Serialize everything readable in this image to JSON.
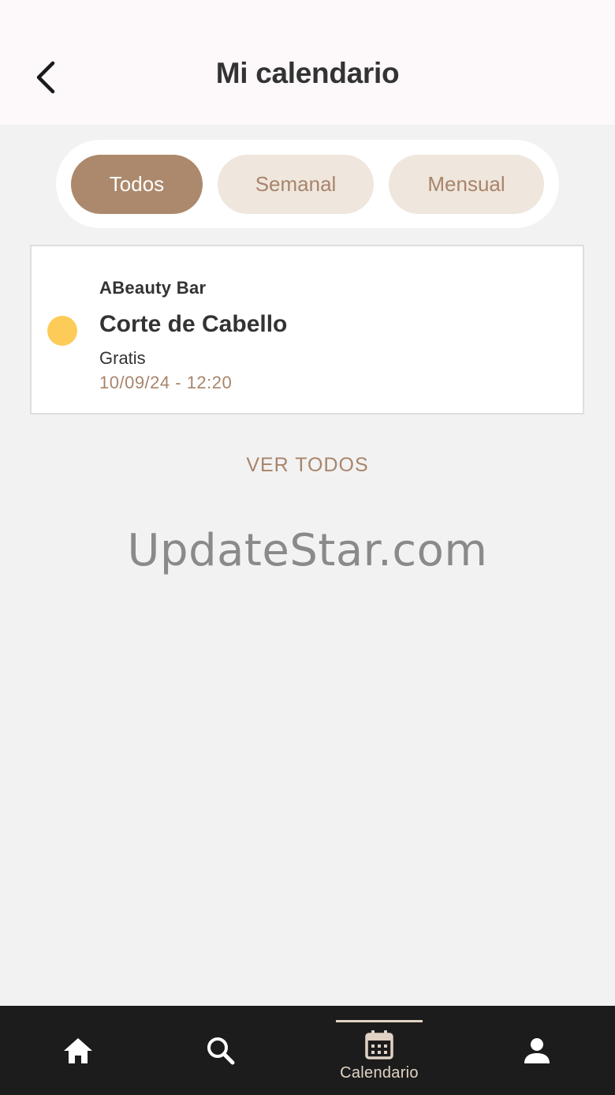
{
  "header": {
    "title": "Mi calendario",
    "back_icon": "chevron-left-icon"
  },
  "filters": [
    {
      "label": "Todos",
      "active": true
    },
    {
      "label": "Semanal",
      "active": false
    },
    {
      "label": "Mensual",
      "active": false
    }
  ],
  "appointment": {
    "salon": "ABeauty Bar",
    "service": "Corte de Cabello",
    "price": "Gratis",
    "datetime": "10/09/24 - 12:20",
    "status_color": "#fdcb58"
  },
  "see_all_label": "VER TODOS",
  "watermark": "UpdateStar.com",
  "tabbar": {
    "items": [
      {
        "icon": "home-icon",
        "label": ""
      },
      {
        "icon": "search-icon",
        "label": ""
      },
      {
        "icon": "calendar-icon",
        "label": "Calendario",
        "active": true
      },
      {
        "icon": "user-icon",
        "label": ""
      }
    ]
  },
  "colors": {
    "accent": "#ac896c",
    "accent_light": "#efe6dd",
    "accent_text": "#a8846a",
    "tabbar_bg": "#1c1c1c"
  }
}
